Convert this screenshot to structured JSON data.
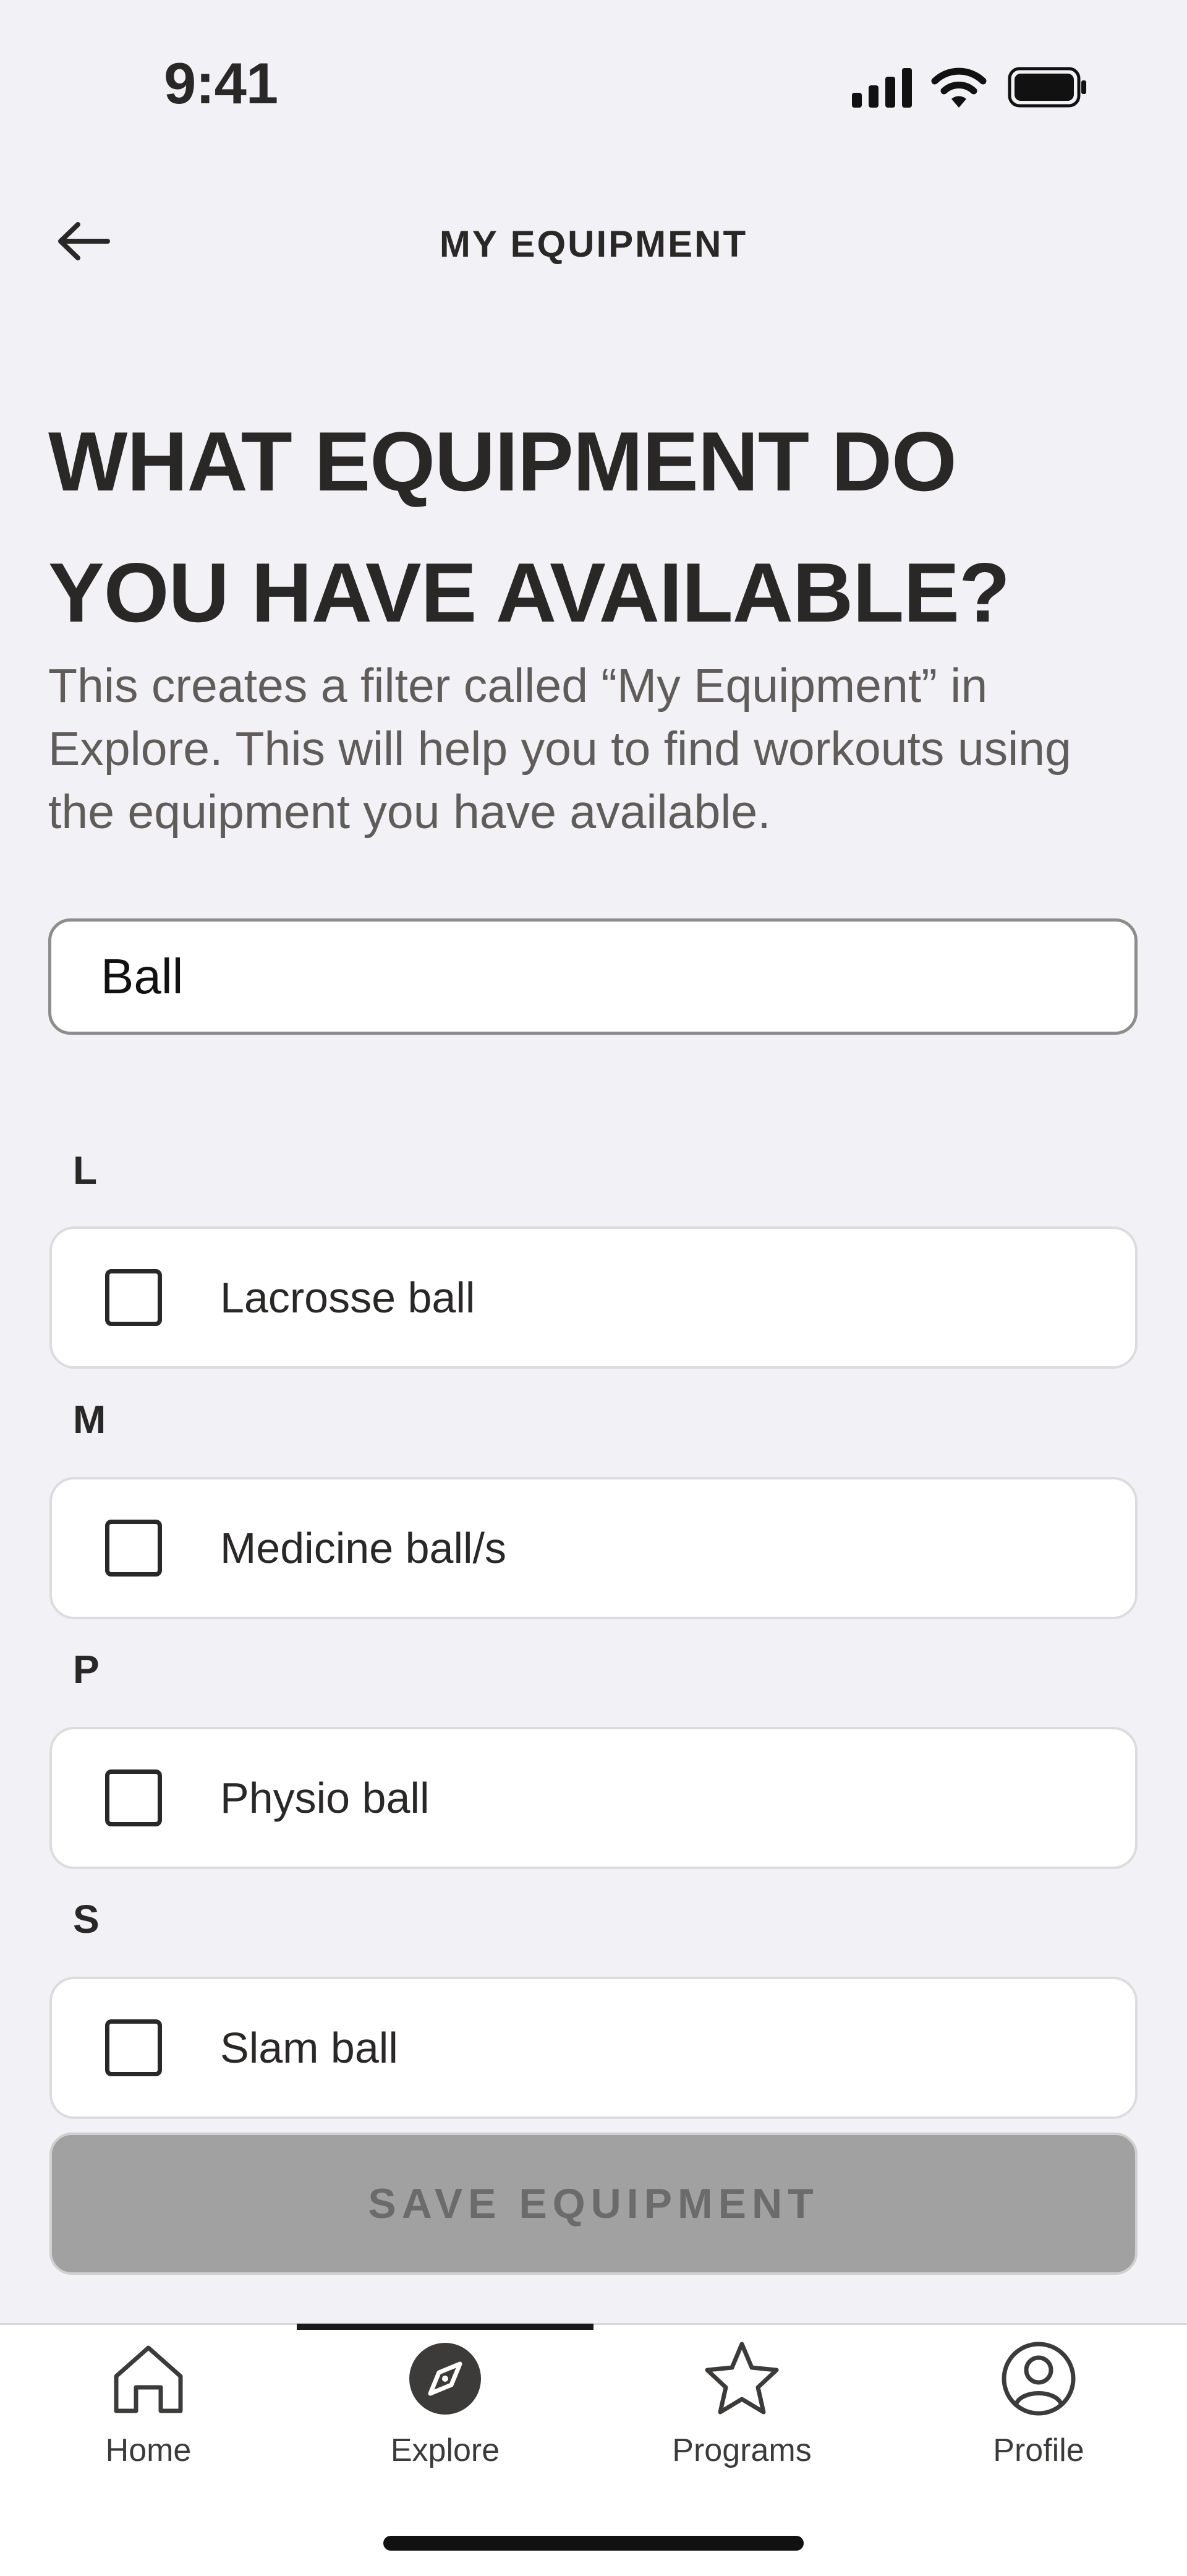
{
  "status_bar": {
    "time": "9:41"
  },
  "header": {
    "title": "MY EQUIPMENT"
  },
  "heading": {
    "line1": "WHAT EQUIPMENT DO",
    "line2": "YOU HAVE AVAILABLE?"
  },
  "description": "This creates a filter called “My Equipment” in Explore. This will help you to find workouts using the equipment you have available.",
  "search": {
    "value": "Ball"
  },
  "groups": [
    {
      "letter": "L",
      "items": [
        {
          "label": "Lacrosse ball",
          "checked": false
        }
      ]
    },
    {
      "letter": "M",
      "items": [
        {
          "label": "Medicine ball/s",
          "checked": false
        }
      ]
    },
    {
      "letter": "P",
      "items": [
        {
          "label": "Physio ball",
          "checked": false
        }
      ]
    },
    {
      "letter": "S",
      "items": [
        {
          "label": "Slam ball",
          "checked": false
        }
      ]
    }
  ],
  "save_button": {
    "label": "SAVE EQUIPMENT",
    "enabled": false
  },
  "tabs": [
    {
      "label": "Home",
      "icon": "home-icon"
    },
    {
      "label": "Explore",
      "icon": "compass-icon",
      "active": true
    },
    {
      "label": "Programs",
      "icon": "star-icon"
    },
    {
      "label": "Profile",
      "icon": "profile-icon"
    }
  ],
  "colors": {
    "background": "#f2f1f5",
    "text": "#2a2827",
    "button_disabled": "#a1a1a1"
  }
}
